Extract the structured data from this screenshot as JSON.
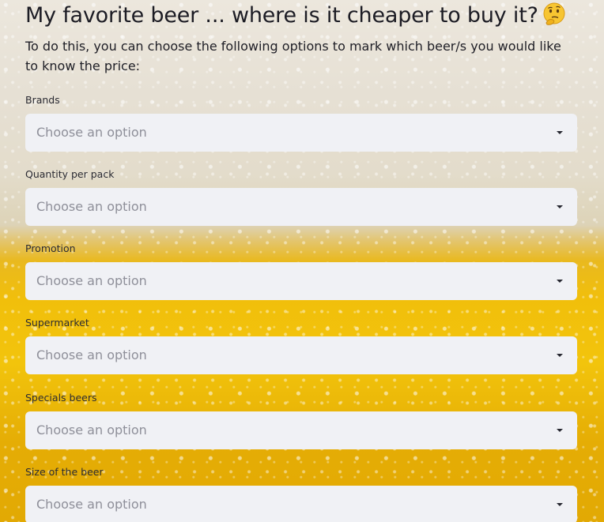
{
  "page": {
    "title": "My favorite beer ... where is it cheaper to buy it?",
    "title_emoji": "thinking-face-icon",
    "intro": "To do this, you can choose the following options to mark which beer/s you would like to know the price:"
  },
  "filters": [
    {
      "label": "Brands",
      "placeholder": "Choose an option"
    },
    {
      "label": "Quantity per pack",
      "placeholder": "Choose an option"
    },
    {
      "label": "Promotion",
      "placeholder": "Choose an option"
    },
    {
      "label": "Supermarket",
      "placeholder": "Choose an option"
    },
    {
      "label": "Specials beers",
      "placeholder": "Choose an option"
    },
    {
      "label": "Size of the beer",
      "placeholder": "Choose an option"
    }
  ],
  "colors": {
    "select_bg": "#f0f1f5",
    "placeholder": "#8e8f99",
    "text": "#1c1c24",
    "beer_gold": "#f1bf0b"
  }
}
